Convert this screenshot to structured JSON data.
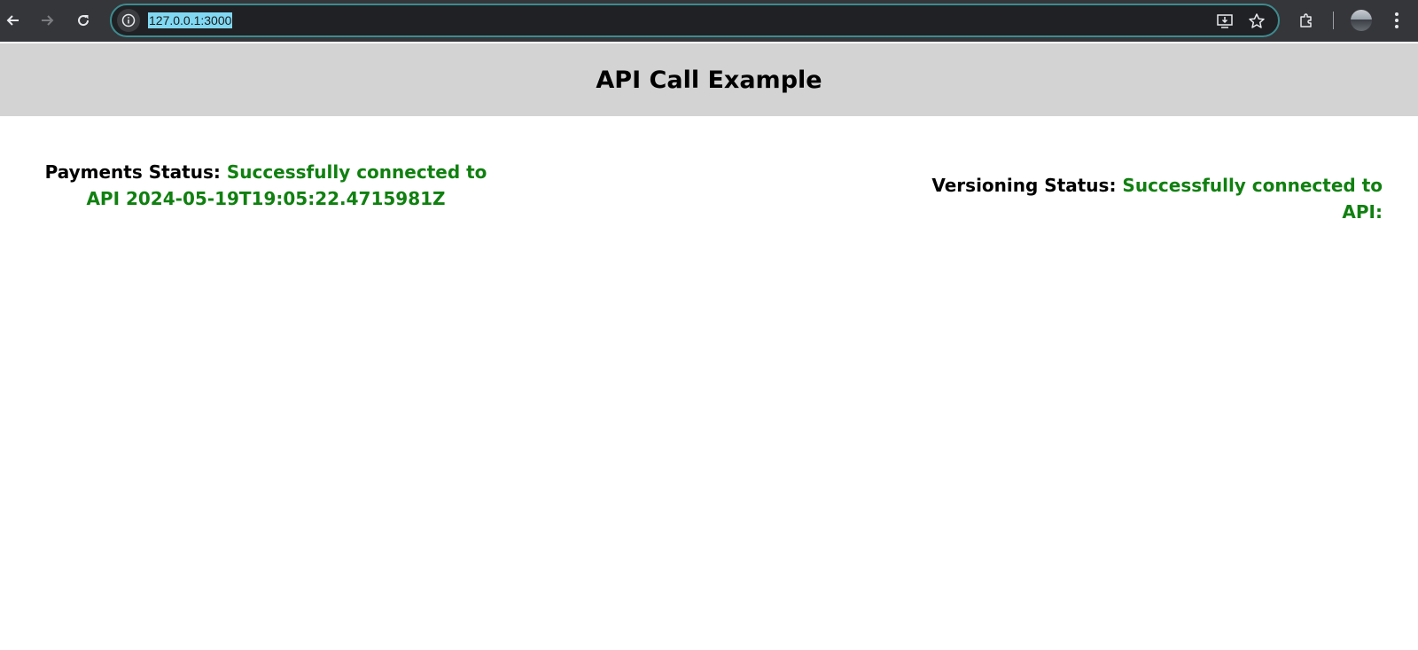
{
  "browser": {
    "url": "127.0.0.1:3000"
  },
  "page": {
    "title": "API Call Example"
  },
  "statuses": {
    "payments": {
      "label": "Payments Status:",
      "value": "Successfully connected to API 2024-05-19T19:05:22.4715981Z"
    },
    "versioning": {
      "label": "Versioning Status:",
      "value": "Successfully connected to API:"
    }
  },
  "colors": {
    "browser_bar": "#35363a",
    "omnibox": "#202124",
    "omnibox_border": "#3d8b8f",
    "url_highlight": "#81d8f3",
    "header_bg": "#d3d3d3",
    "status_success": "#108010"
  }
}
